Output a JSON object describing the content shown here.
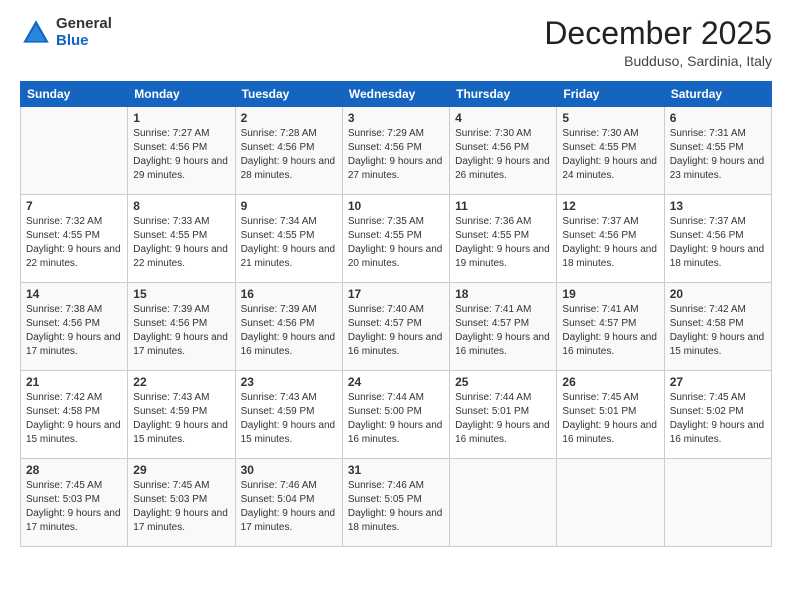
{
  "header": {
    "logo_general": "General",
    "logo_blue": "Blue",
    "month_title": "December 2025",
    "location": "Budduso, Sardinia, Italy"
  },
  "days_of_week": [
    "Sunday",
    "Monday",
    "Tuesday",
    "Wednesday",
    "Thursday",
    "Friday",
    "Saturday"
  ],
  "weeks": [
    [
      {
        "day": "",
        "sunrise": "",
        "sunset": "",
        "daylight": ""
      },
      {
        "day": "1",
        "sunrise": "Sunrise: 7:27 AM",
        "sunset": "Sunset: 4:56 PM",
        "daylight": "Daylight: 9 hours and 29 minutes."
      },
      {
        "day": "2",
        "sunrise": "Sunrise: 7:28 AM",
        "sunset": "Sunset: 4:56 PM",
        "daylight": "Daylight: 9 hours and 28 minutes."
      },
      {
        "day": "3",
        "sunrise": "Sunrise: 7:29 AM",
        "sunset": "Sunset: 4:56 PM",
        "daylight": "Daylight: 9 hours and 27 minutes."
      },
      {
        "day": "4",
        "sunrise": "Sunrise: 7:30 AM",
        "sunset": "Sunset: 4:56 PM",
        "daylight": "Daylight: 9 hours and 26 minutes."
      },
      {
        "day": "5",
        "sunrise": "Sunrise: 7:30 AM",
        "sunset": "Sunset: 4:55 PM",
        "daylight": "Daylight: 9 hours and 24 minutes."
      },
      {
        "day": "6",
        "sunrise": "Sunrise: 7:31 AM",
        "sunset": "Sunset: 4:55 PM",
        "daylight": "Daylight: 9 hours and 23 minutes."
      }
    ],
    [
      {
        "day": "7",
        "sunrise": "Sunrise: 7:32 AM",
        "sunset": "Sunset: 4:55 PM",
        "daylight": "Daylight: 9 hours and 22 minutes."
      },
      {
        "day": "8",
        "sunrise": "Sunrise: 7:33 AM",
        "sunset": "Sunset: 4:55 PM",
        "daylight": "Daylight: 9 hours and 22 minutes."
      },
      {
        "day": "9",
        "sunrise": "Sunrise: 7:34 AM",
        "sunset": "Sunset: 4:55 PM",
        "daylight": "Daylight: 9 hours and 21 minutes."
      },
      {
        "day": "10",
        "sunrise": "Sunrise: 7:35 AM",
        "sunset": "Sunset: 4:55 PM",
        "daylight": "Daylight: 9 hours and 20 minutes."
      },
      {
        "day": "11",
        "sunrise": "Sunrise: 7:36 AM",
        "sunset": "Sunset: 4:55 PM",
        "daylight": "Daylight: 9 hours and 19 minutes."
      },
      {
        "day": "12",
        "sunrise": "Sunrise: 7:37 AM",
        "sunset": "Sunset: 4:56 PM",
        "daylight": "Daylight: 9 hours and 18 minutes."
      },
      {
        "day": "13",
        "sunrise": "Sunrise: 7:37 AM",
        "sunset": "Sunset: 4:56 PM",
        "daylight": "Daylight: 9 hours and 18 minutes."
      }
    ],
    [
      {
        "day": "14",
        "sunrise": "Sunrise: 7:38 AM",
        "sunset": "Sunset: 4:56 PM",
        "daylight": "Daylight: 9 hours and 17 minutes."
      },
      {
        "day": "15",
        "sunrise": "Sunrise: 7:39 AM",
        "sunset": "Sunset: 4:56 PM",
        "daylight": "Daylight: 9 hours and 17 minutes."
      },
      {
        "day": "16",
        "sunrise": "Sunrise: 7:39 AM",
        "sunset": "Sunset: 4:56 PM",
        "daylight": "Daylight: 9 hours and 16 minutes."
      },
      {
        "day": "17",
        "sunrise": "Sunrise: 7:40 AM",
        "sunset": "Sunset: 4:57 PM",
        "daylight": "Daylight: 9 hours and 16 minutes."
      },
      {
        "day": "18",
        "sunrise": "Sunrise: 7:41 AM",
        "sunset": "Sunset: 4:57 PM",
        "daylight": "Daylight: 9 hours and 16 minutes."
      },
      {
        "day": "19",
        "sunrise": "Sunrise: 7:41 AM",
        "sunset": "Sunset: 4:57 PM",
        "daylight": "Daylight: 9 hours and 16 minutes."
      },
      {
        "day": "20",
        "sunrise": "Sunrise: 7:42 AM",
        "sunset": "Sunset: 4:58 PM",
        "daylight": "Daylight: 9 hours and 15 minutes."
      }
    ],
    [
      {
        "day": "21",
        "sunrise": "Sunrise: 7:42 AM",
        "sunset": "Sunset: 4:58 PM",
        "daylight": "Daylight: 9 hours and 15 minutes."
      },
      {
        "day": "22",
        "sunrise": "Sunrise: 7:43 AM",
        "sunset": "Sunset: 4:59 PM",
        "daylight": "Daylight: 9 hours and 15 minutes."
      },
      {
        "day": "23",
        "sunrise": "Sunrise: 7:43 AM",
        "sunset": "Sunset: 4:59 PM",
        "daylight": "Daylight: 9 hours and 15 minutes."
      },
      {
        "day": "24",
        "sunrise": "Sunrise: 7:44 AM",
        "sunset": "Sunset: 5:00 PM",
        "daylight": "Daylight: 9 hours and 16 minutes."
      },
      {
        "day": "25",
        "sunrise": "Sunrise: 7:44 AM",
        "sunset": "Sunset: 5:01 PM",
        "daylight": "Daylight: 9 hours and 16 minutes."
      },
      {
        "day": "26",
        "sunrise": "Sunrise: 7:45 AM",
        "sunset": "Sunset: 5:01 PM",
        "daylight": "Daylight: 9 hours and 16 minutes."
      },
      {
        "day": "27",
        "sunrise": "Sunrise: 7:45 AM",
        "sunset": "Sunset: 5:02 PM",
        "daylight": "Daylight: 9 hours and 16 minutes."
      }
    ],
    [
      {
        "day": "28",
        "sunrise": "Sunrise: 7:45 AM",
        "sunset": "Sunset: 5:03 PM",
        "daylight": "Daylight: 9 hours and 17 minutes."
      },
      {
        "day": "29",
        "sunrise": "Sunrise: 7:45 AM",
        "sunset": "Sunset: 5:03 PM",
        "daylight": "Daylight: 9 hours and 17 minutes."
      },
      {
        "day": "30",
        "sunrise": "Sunrise: 7:46 AM",
        "sunset": "Sunset: 5:04 PM",
        "daylight": "Daylight: 9 hours and 17 minutes."
      },
      {
        "day": "31",
        "sunrise": "Sunrise: 7:46 AM",
        "sunset": "Sunset: 5:05 PM",
        "daylight": "Daylight: 9 hours and 18 minutes."
      },
      {
        "day": "",
        "sunrise": "",
        "sunset": "",
        "daylight": ""
      },
      {
        "day": "",
        "sunrise": "",
        "sunset": "",
        "daylight": ""
      },
      {
        "day": "",
        "sunrise": "",
        "sunset": "",
        "daylight": ""
      }
    ]
  ]
}
